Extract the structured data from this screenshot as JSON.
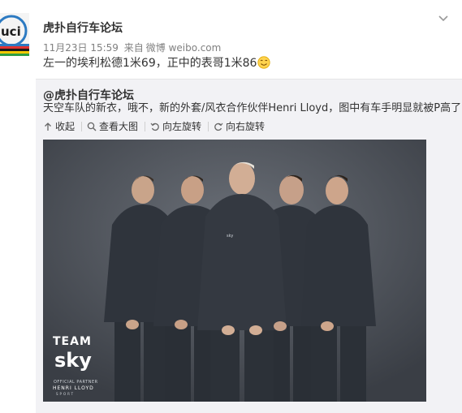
{
  "post": {
    "author": "虎扑自行车论坛",
    "date": "11月23日 15:59",
    "source_prefix": "来自",
    "source": "微博 weibo.com",
    "text": "左一的埃利松德1米69，正中的表哥1米86"
  },
  "repost": {
    "author": "@虎扑自行车论坛",
    "text": "天空车队的新衣，哦不，新的外套/风衣合作伙伴Henri Lloyd，图中有车手明显就被P高了",
    "actions": {
      "collapse": "收起",
      "view_large": "查看大图",
      "rotate_left": "向左旋转",
      "rotate_right": "向右旋转"
    }
  },
  "photo": {
    "logo_team": "TEAM",
    "logo_sky": "sky",
    "logo_partner": "OFFICIAL PARTNER",
    "logo_brand": "HENRI LLOYD",
    "logo_brand_sub": "SPORT",
    "jacket_brand": "sky"
  },
  "colors": {
    "accent": "#eb7350",
    "link": "#333333",
    "meta": "#808080",
    "repost_bg": "#f2f2f5",
    "photo_bg": "#4a4f56",
    "jacket": "#2f343c"
  },
  "icons": {
    "avatar": "uci-logo-avatar",
    "expand": "chevron-down-icon",
    "collapse": "arrow-up-icon",
    "view_large": "magnifier-icon",
    "rotate_left": "rotate-left-icon",
    "rotate_right": "rotate-right-icon",
    "emoji": "smile-emoji-icon"
  }
}
